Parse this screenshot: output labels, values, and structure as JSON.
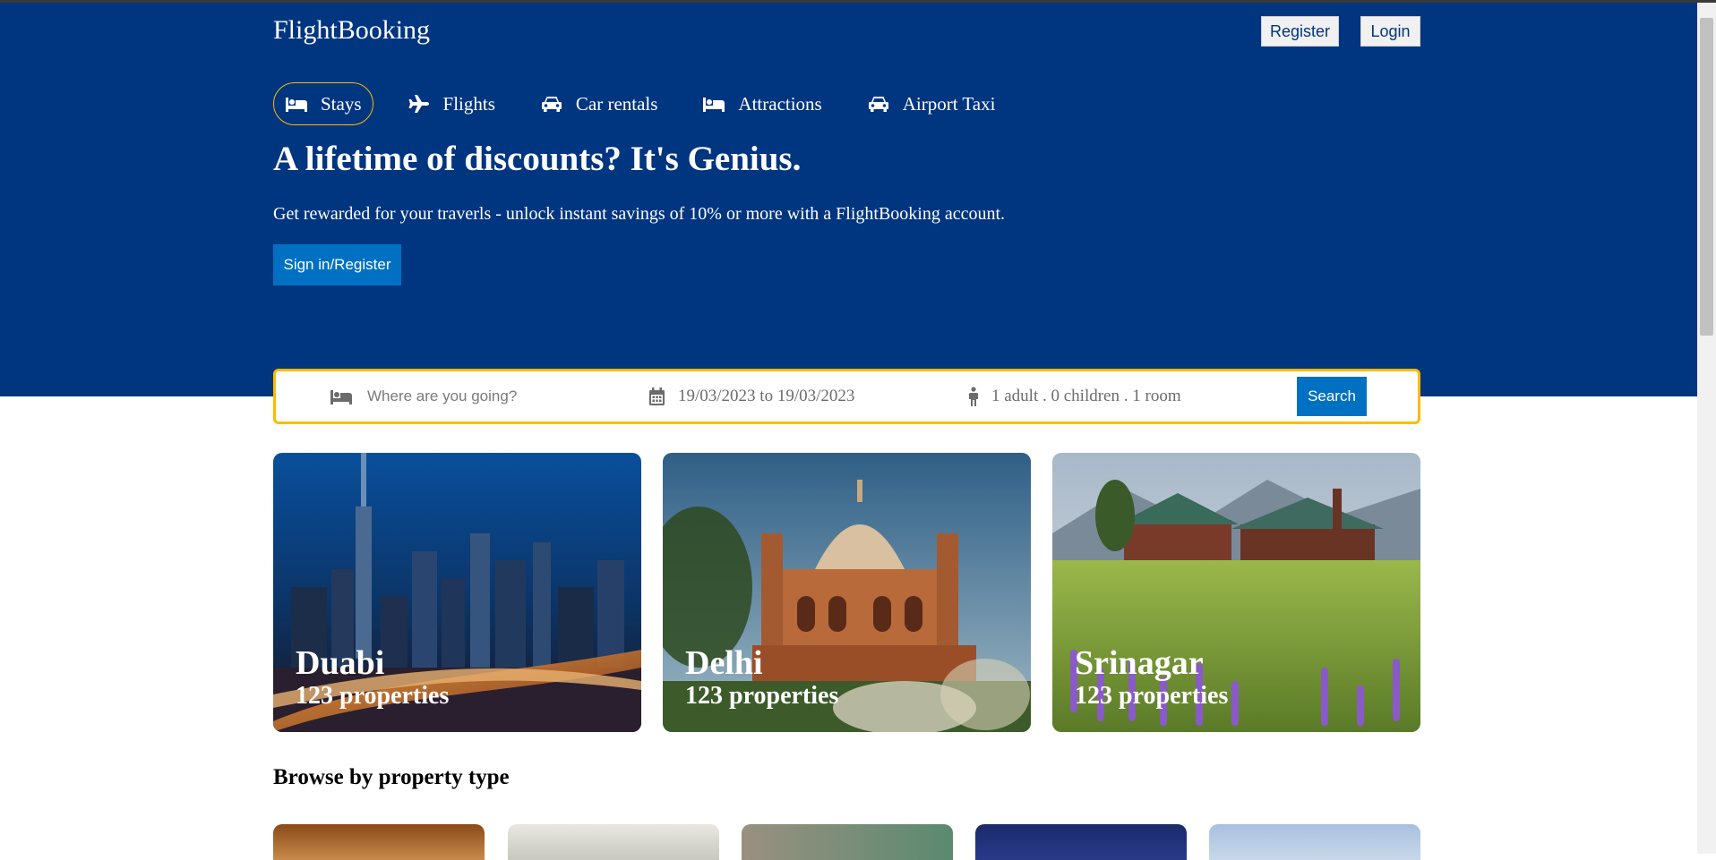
{
  "header": {
    "logo": "FlightBooking",
    "register_label": "Register",
    "login_label": "Login"
  },
  "nav": [
    {
      "label": "Stays",
      "icon": "bed-icon",
      "active": true
    },
    {
      "label": "Flights",
      "icon": "plane-icon",
      "active": false
    },
    {
      "label": "Car rentals",
      "icon": "car-icon",
      "active": false
    },
    {
      "label": "Attractions",
      "icon": "bed-icon",
      "active": false
    },
    {
      "label": "Airport Taxi",
      "icon": "taxi-icon",
      "active": false
    }
  ],
  "hero": {
    "headline": "A lifetime of discounts? It's Genius.",
    "subtext": "Get rewarded for your traverls - unlock instant savings of 10% or more with a FlightBooking account.",
    "cta_label": "Sign in/Register"
  },
  "search": {
    "destination_placeholder": "Where are you going?",
    "dates": "19/03/2023 to 19/03/2023",
    "guests": "1 adult . 0 children . 1 room",
    "button_label": "Search"
  },
  "featured": [
    {
      "name": "Duabi",
      "properties": "123 properties"
    },
    {
      "name": "Delhi",
      "properties": "123 properties"
    },
    {
      "name": "Srinagar",
      "properties": "123 properties"
    }
  ],
  "browse": {
    "title": "Browse by property type"
  },
  "colors": {
    "brand_blue": "#003580",
    "accent_yellow": "#febb02",
    "button_blue": "#0071c2"
  }
}
